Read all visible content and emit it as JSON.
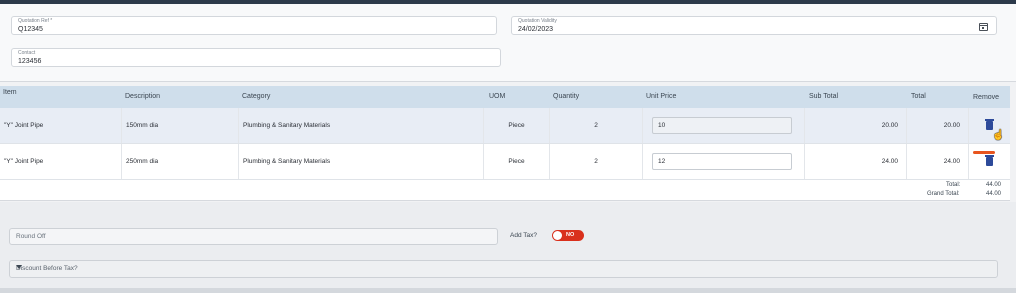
{
  "form": {
    "quotation_ref": {
      "label": "Quotation Ref *",
      "value": "Q12345"
    },
    "quotation_validity": {
      "label": "Quotation Validity",
      "value": "24/02/2023"
    },
    "contact": {
      "label": "Contact",
      "value": "123456"
    }
  },
  "table": {
    "headers": [
      "Item",
      "Description",
      "Category",
      "UOM",
      "Quantity",
      "Unit Price",
      "Sub Total",
      "Total",
      "Remove"
    ],
    "rows": [
      {
        "item": "\"Y\" Joint Pipe",
        "description": "150mm dia",
        "category": "Plumbing & Sanitary Materials",
        "uom": "Piece",
        "quantity": "2",
        "unit_price": "10",
        "sub_total": "20.00",
        "total": "20.00"
      },
      {
        "item": "\"Y\" Joint Pipe",
        "description": "250mm dia",
        "category": "Plumbing & Sanitary Materials",
        "uom": "Piece",
        "quantity": "2",
        "unit_price": "12",
        "sub_total": "24.00",
        "total": "24.00"
      }
    ]
  },
  "totals": {
    "total_label": "Total:",
    "total_value": "44.00",
    "grand_total_label": "Grand Total:",
    "grand_total_value": "44.00"
  },
  "options": {
    "round_off_placeholder": "Round Off",
    "add_tax_label": "Add Tax?",
    "add_tax_state": "NO",
    "discount_placeholder": "Discount Before Tax?"
  },
  "colors": {
    "header_bg": "#cfdeeb",
    "toggle_off": "#d9301c",
    "trash_icon": "#2d4a9a",
    "highlight": "#e8551e"
  },
  "icons": [
    "calendar-icon",
    "trash-icon",
    "chevron-down-icon",
    "cursor-hand-icon"
  ]
}
